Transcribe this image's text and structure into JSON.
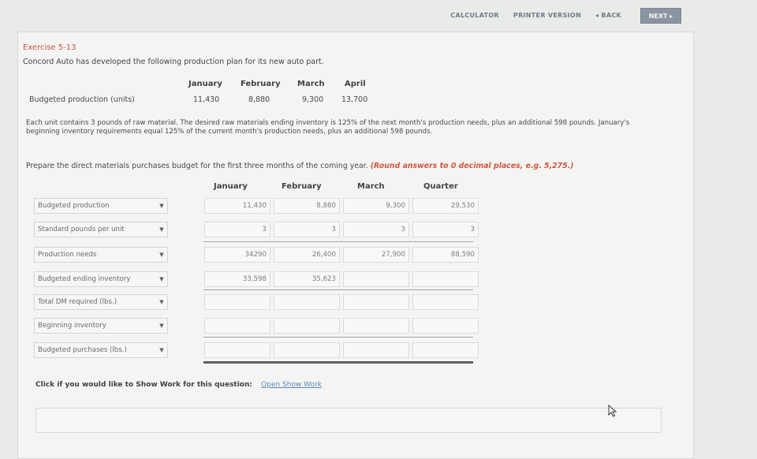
{
  "toolbar": {
    "calculator": "CALCULATOR",
    "printer": "PRINTER VERSION",
    "back": "◂ BACK",
    "next": "NEXT ▸"
  },
  "exercise": {
    "title": "Exercise 5-13",
    "intro": "Concord Auto has developed the following production plan for its new auto part."
  },
  "plan": {
    "headers": [
      "January",
      "February",
      "March",
      "April"
    ],
    "row_label": "Budgeted production (units)",
    "values": [
      "11,430",
      "8,880",
      "9,300",
      "13,700"
    ]
  },
  "description": "Each unit contains 3 pounds of raw material. The desired raw materials ending inventory is 125% of the next month's production needs, plus an additional 598 pounds. January's beginning inventory requirements equal 125% of the current month's production needs, plus an additional 598 pounds.",
  "prepare": {
    "text": "Prepare the direct materials purchases budget for the first three months of the coming year.",
    "hint": "(Round answers to 0 decimal places, e.g. 5,275.)"
  },
  "budget": {
    "headers": [
      "January",
      "February",
      "March",
      "Quarter"
    ],
    "rows": [
      {
        "label": "Budgeted production",
        "values": [
          "11,430",
          "8,880",
          "9,300",
          "29,530"
        ]
      },
      {
        "label": "Standard pounds per unit",
        "values": [
          "3",
          "3",
          "3",
          "3"
        ]
      },
      {
        "label": "Production needs",
        "values": [
          "34290",
          "26,400",
          "27,900",
          "88,590"
        ]
      },
      {
        "label": "Budgeted ending inventory",
        "values": [
          "33,598",
          "35,623",
          "",
          ""
        ]
      },
      {
        "label": "Total DM required (lbs.)",
        "values": [
          "",
          "",
          "",
          ""
        ]
      },
      {
        "label": "Beginning inventory",
        "values": [
          "",
          "",
          "",
          ""
        ]
      },
      {
        "label": "Budgeted purchases (lbs.)",
        "values": [
          "",
          "",
          "",
          ""
        ]
      }
    ]
  },
  "showwork": {
    "prompt": "Click if you would like to Show Work for this question:",
    "link": "Open Show Work"
  }
}
